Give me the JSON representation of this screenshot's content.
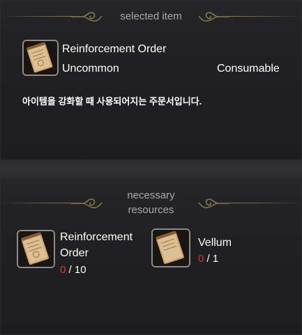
{
  "selected_item": {
    "header": "selected item",
    "name": "Reinforcement Order",
    "rarity": "Uncommon",
    "type": "Consumable",
    "description": "아이템을 강화할 때 사용되어지는 주문서입니다.",
    "icon": "scroll-document-icon"
  },
  "necessary_resources": {
    "header_line1": "necessary",
    "header_line2": "resources",
    "items": [
      {
        "name_line1": "Reinforcement",
        "name_line2": "Order",
        "have": "0",
        "need": "/ 10",
        "icon": "scroll-document-icon"
      },
      {
        "name_line1": "Vellum",
        "name_line2": "",
        "have": "0",
        "need": "/ 1",
        "icon": "vellum-document-icon"
      }
    ]
  },
  "colors": {
    "accent_gold": "#8a7b52",
    "shortage_red": "#d23a32",
    "text_white": "#ffffff",
    "header_gray": "#a8a8a8"
  }
}
